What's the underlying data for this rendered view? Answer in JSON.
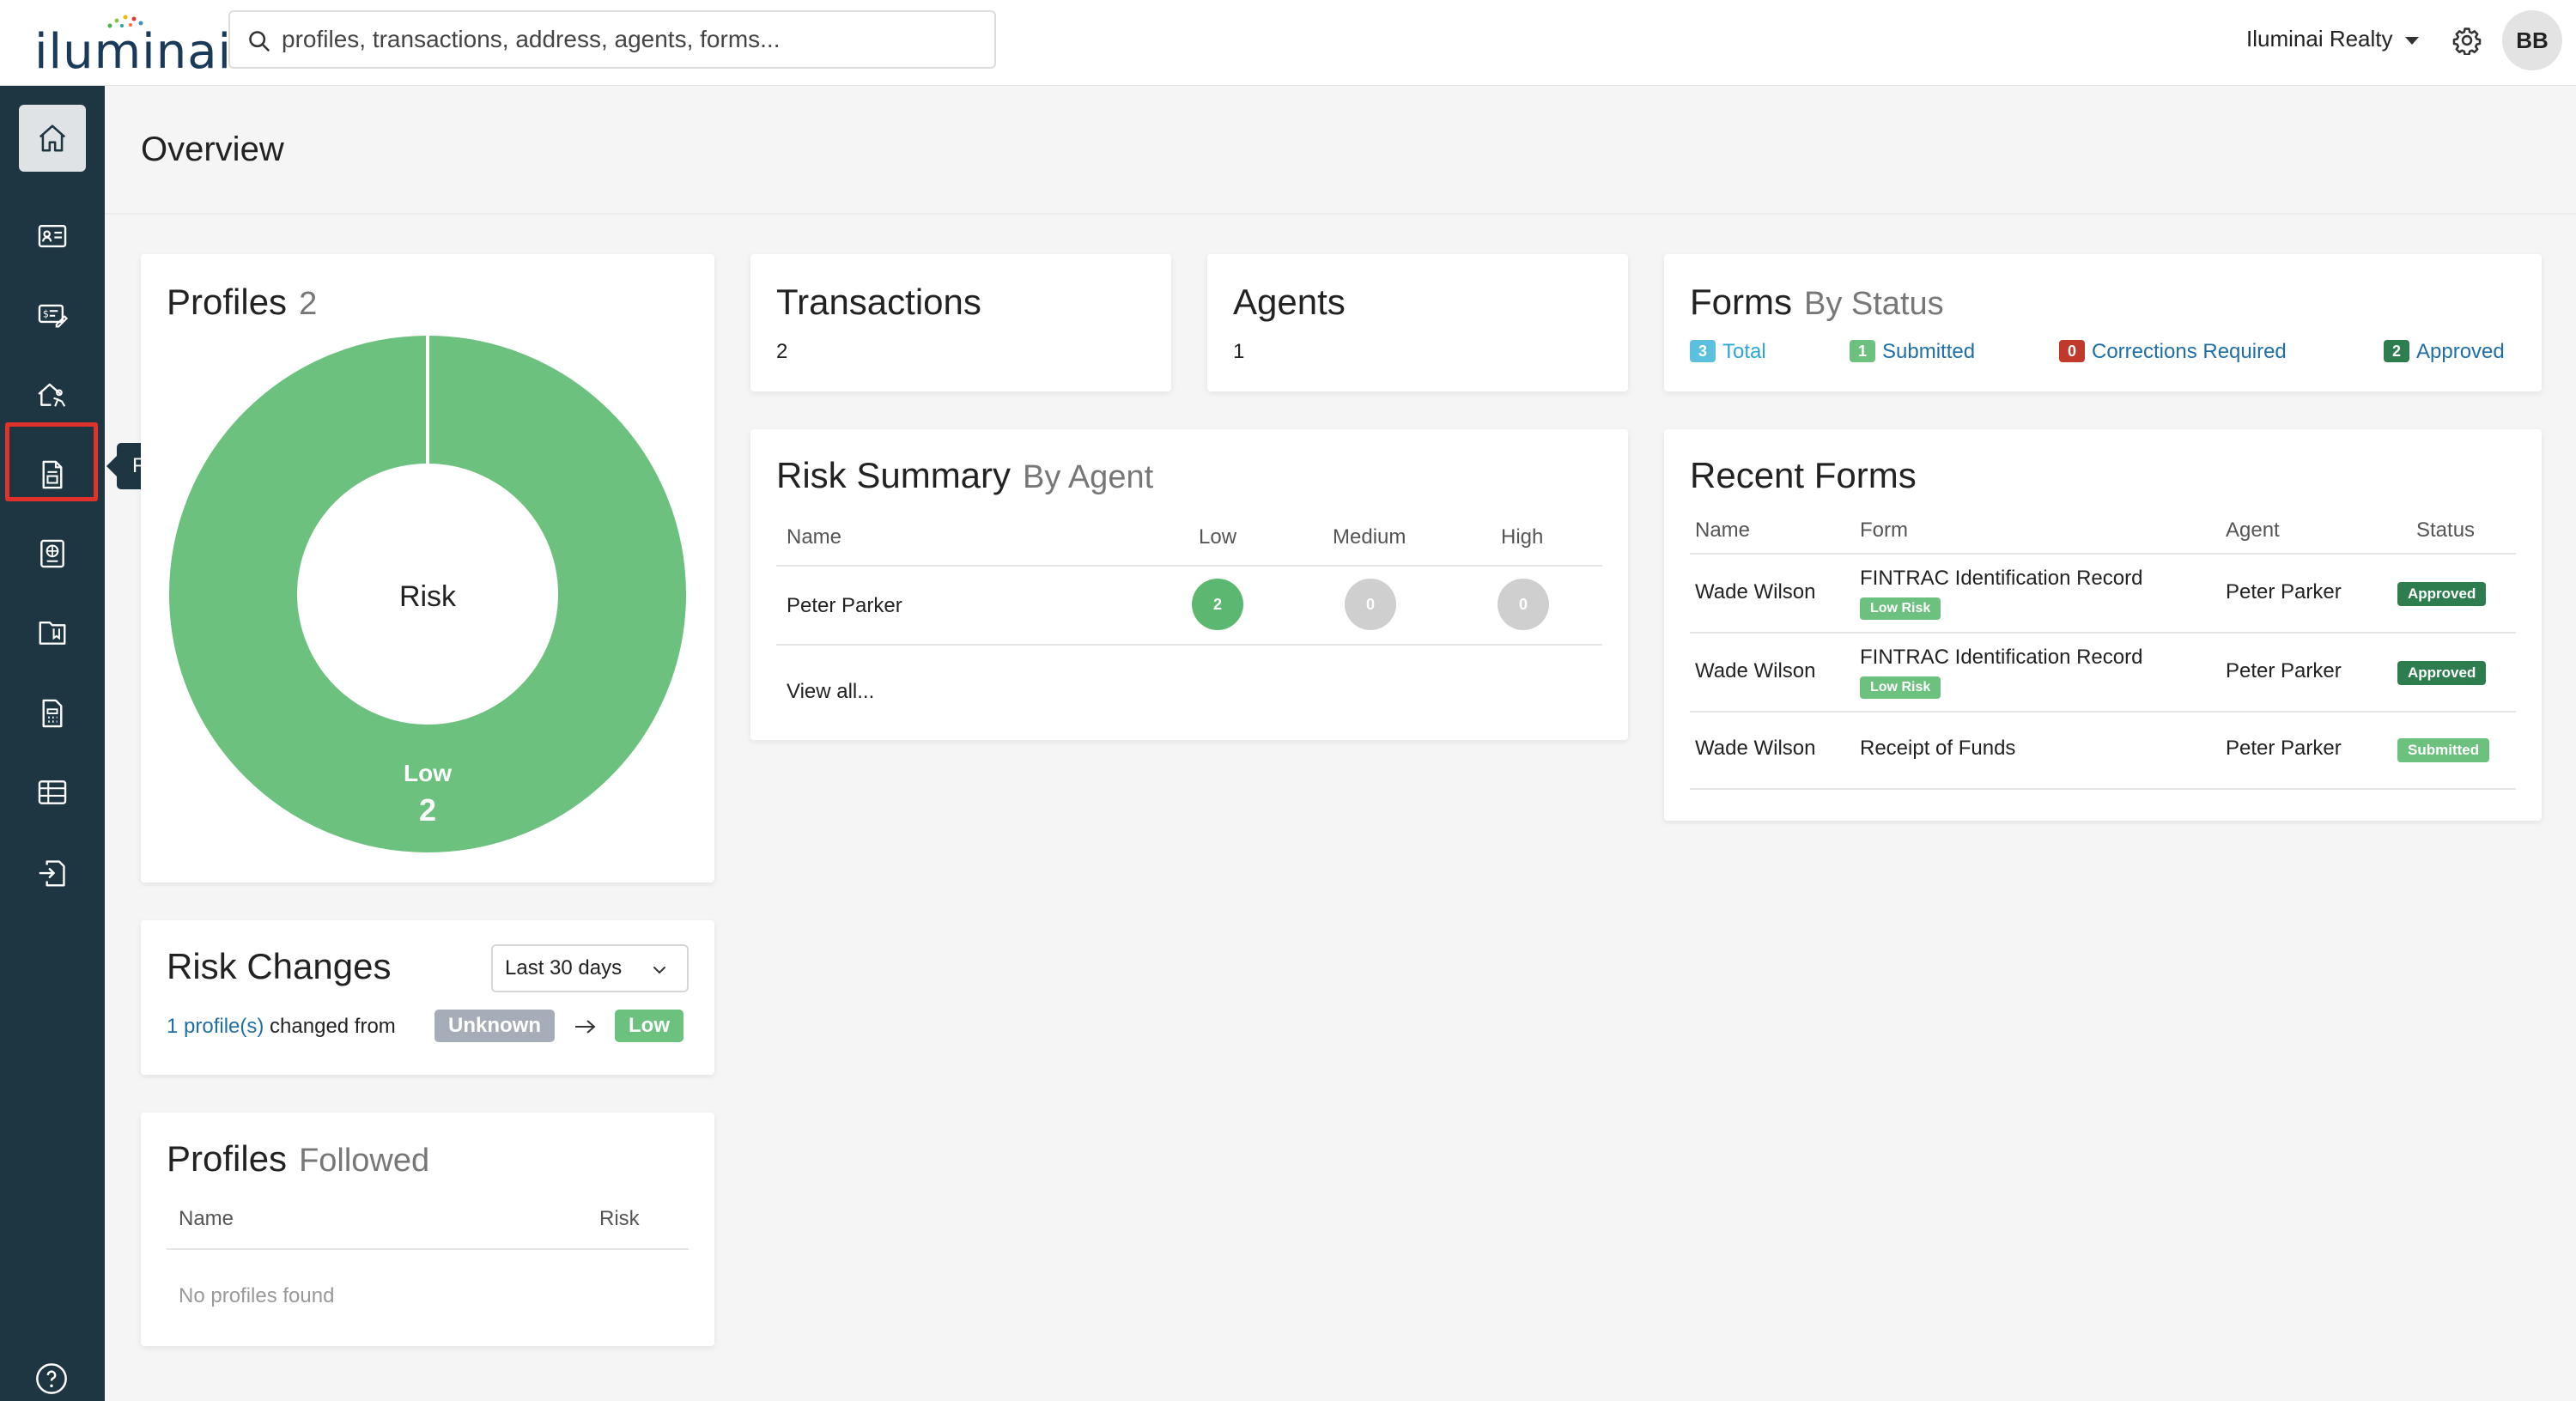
{
  "app": {
    "logo_text": "iluminai",
    "search_placeholder": "profiles, transactions, address, agents, forms...",
    "org_name": "Iluminai Realty",
    "avatar_initials": "BB"
  },
  "sidebar": {
    "items": [
      {
        "icon": "home-icon",
        "active": true
      },
      {
        "icon": "profiles-icon"
      },
      {
        "icon": "transactions-icon"
      },
      {
        "icon": "agents-icon"
      },
      {
        "icon": "forms-icon",
        "highlighted": true
      },
      {
        "icon": "reports-icon"
      },
      {
        "icon": "library-icon"
      },
      {
        "icon": "calculator-icon"
      },
      {
        "icon": "table-icon"
      },
      {
        "icon": "import-icon"
      }
    ],
    "tooltip": "Forms",
    "help_icon": "help-icon"
  },
  "page": {
    "title": "Overview"
  },
  "profiles": {
    "title": "Profiles",
    "count": "2",
    "center_label": "Risk",
    "segment_label": "Low",
    "segment_value": "2",
    "segment_color": "#6cc17e"
  },
  "transactions": {
    "title": "Transactions",
    "value": "2"
  },
  "agents": {
    "title": "Agents",
    "value": "1"
  },
  "forms_status": {
    "title": "Forms",
    "subtitle": "By Status",
    "items": [
      {
        "count": "3",
        "label": "Total",
        "color": "#5bc0de"
      },
      {
        "count": "1",
        "label": "Submitted",
        "color": "#6cc17e"
      },
      {
        "count": "0",
        "label": "Corrections Required",
        "color": "#c0392b"
      },
      {
        "count": "2",
        "label": "Approved",
        "color": "#2e7d4f"
      }
    ]
  },
  "risk_summary": {
    "title": "Risk Summary",
    "subtitle": "By Agent",
    "headers": {
      "name": "Name",
      "low": "Low",
      "medium": "Medium",
      "high": "High"
    },
    "rows": [
      {
        "name": "Peter Parker",
        "low": "2",
        "medium": "0",
        "high": "0"
      }
    ],
    "view_all": "View all..."
  },
  "recent_forms": {
    "title": "Recent Forms",
    "headers": {
      "name": "Name",
      "form": "Form",
      "agent": "Agent",
      "status": "Status"
    },
    "rows": [
      {
        "name": "Wade Wilson",
        "form": "FINTRAC Identification Record",
        "risk": "Low Risk",
        "agent": "Peter Parker",
        "status": "Approved"
      },
      {
        "name": "Wade Wilson",
        "form": "FINTRAC Identification Record",
        "risk": "Low Risk",
        "agent": "Peter Parker",
        "status": "Approved"
      },
      {
        "name": "Wade Wilson",
        "form": "Receipt of Funds",
        "risk": "",
        "agent": "Peter Parker",
        "status": "Submitted"
      }
    ]
  },
  "risk_changes": {
    "title": "Risk Changes",
    "range": "Last 30 days",
    "link_text": "1 profile(s)",
    "middle_text": "changed from",
    "from": "Unknown",
    "to": "Low"
  },
  "profiles_followed": {
    "title": "Profiles",
    "subtitle": "Followed",
    "headers": {
      "name": "Name",
      "risk": "Risk"
    },
    "empty": "No profiles found"
  }
}
